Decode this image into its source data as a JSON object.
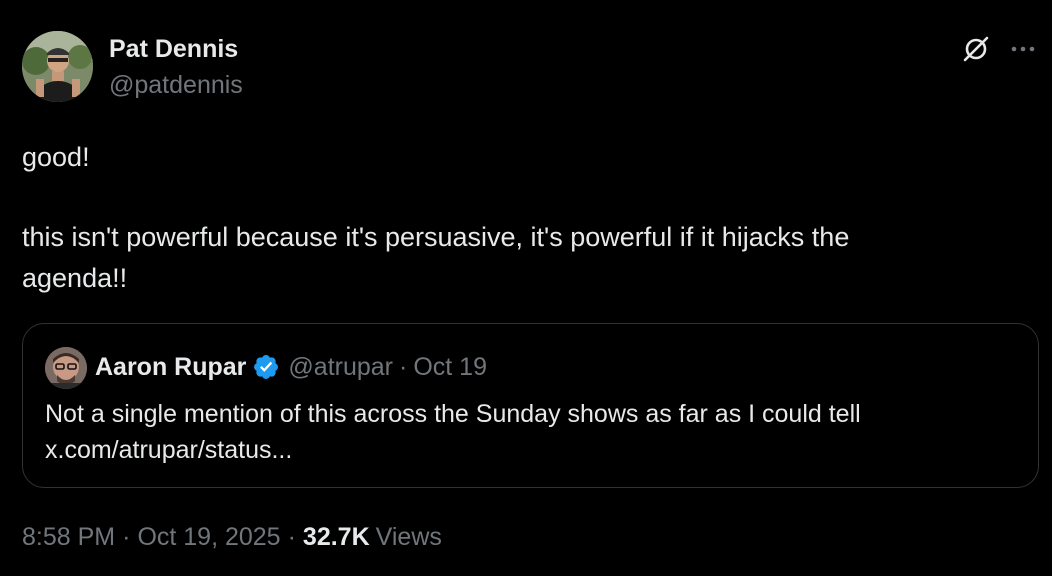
{
  "author": {
    "name": "Pat Dennis",
    "handle": "@patdennis"
  },
  "actions": {
    "grok_icon": "grok-icon",
    "more_icon": "more-icon"
  },
  "tweet": {
    "lines": [
      "good!",
      "this isn't powerful because it's persuasive, it's powerful if it hijacks the",
      "agenda!!"
    ]
  },
  "quoted": {
    "name": "Aaron Rupar",
    "verified": true,
    "handle": "@atrupar",
    "separator": "·",
    "date": "Oct 19",
    "text_lines": [
      "Not a single mention of this across the Sunday shows as far as I could tell",
      "x.com/atrupar/status..."
    ]
  },
  "footer": {
    "time": "8:58 PM",
    "separator": "·",
    "date": "Oct 19, 2025",
    "views_count": "32.7K",
    "views_label": "Views"
  },
  "colors": {
    "background": "#000000",
    "text_primary": "#e7e9ea",
    "text_secondary": "#71767b",
    "border": "#2f3336",
    "verified_blue": "#1d9bf0"
  }
}
